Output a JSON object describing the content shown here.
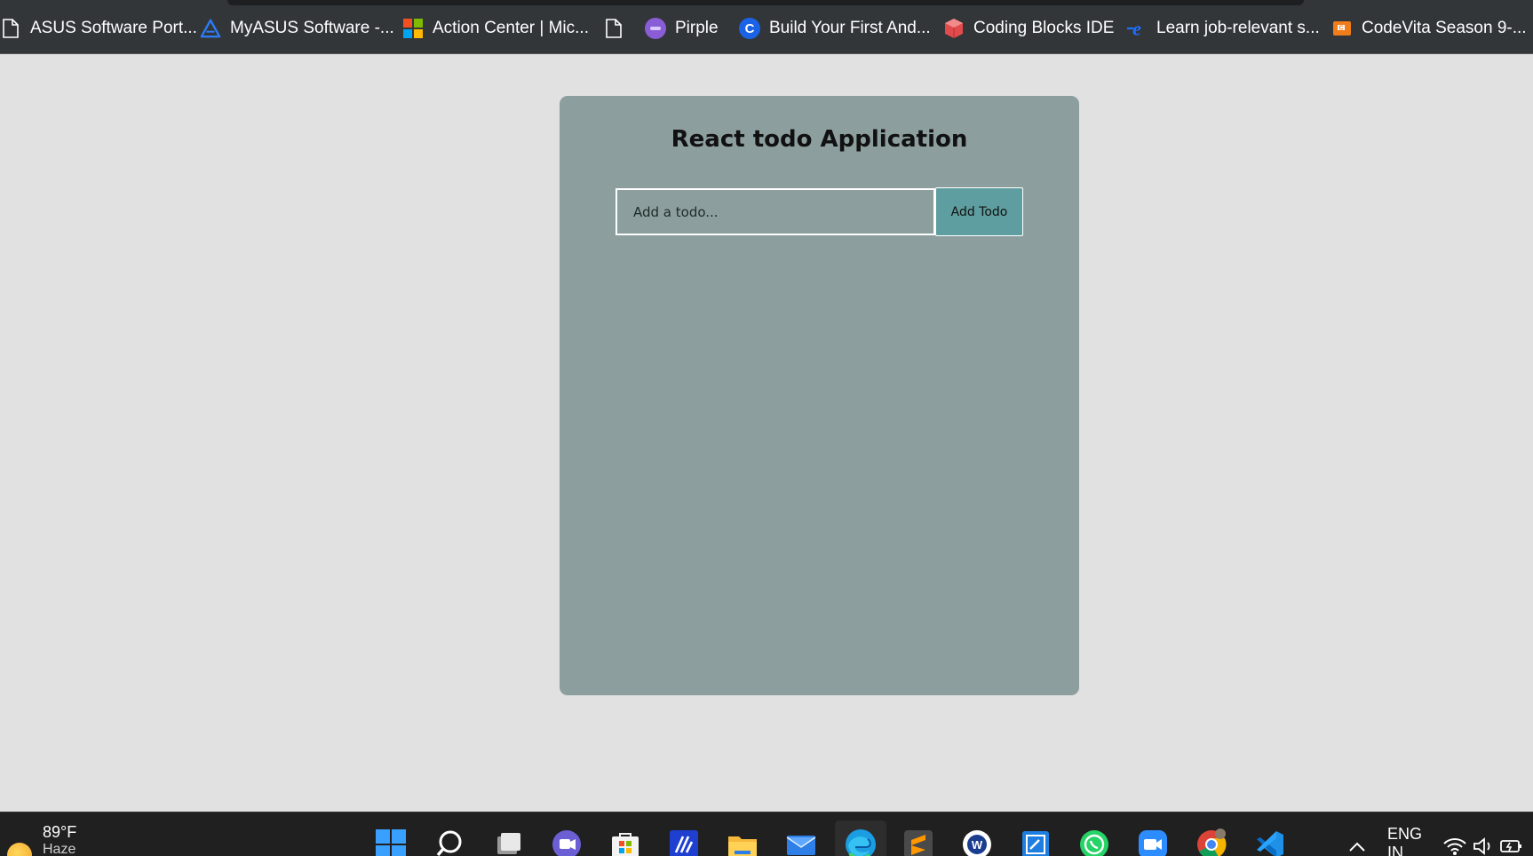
{
  "bookmarks": [
    {
      "label": "ASUS Software Port...",
      "icon": "file-icon"
    },
    {
      "label": "MyASUS Software -...",
      "icon": "myasus-icon"
    },
    {
      "label": "Action Center | Mic...",
      "icon": "microsoft-icon"
    },
    {
      "label": "",
      "icon": "file-icon"
    },
    {
      "label": "Pirple",
      "icon": "pirple-icon"
    },
    {
      "label": "Build Your First And...",
      "icon": "build-icon"
    },
    {
      "label": "Coding Blocks IDE",
      "icon": "coding-blocks-icon"
    },
    {
      "label": "Learn job-relevant s...",
      "icon": "learn-icon"
    },
    {
      "label": "CodeVita Season 9-...",
      "icon": "codevita-icon"
    }
  ],
  "app": {
    "title": "React todo Application",
    "input": {
      "placeholder": "Add a todo...",
      "value": ""
    },
    "add_button_label": "Add Todo"
  },
  "taskbar": {
    "weather": {
      "temperature": "89°F",
      "condition": "Haze"
    },
    "apps": [
      "start-icon",
      "search-icon",
      "task-view-icon",
      "teams-chat-icon",
      "microsoft-store-icon",
      "myasus-app-icon",
      "file-explorer-icon",
      "mail-icon",
      "edge-icon",
      "sublime-text-icon",
      "word-icon",
      "whiteboard-icon",
      "whatsapp-icon",
      "zoom-icon",
      "chrome-icon",
      "vscode-icon"
    ],
    "tray": {
      "language": "ENG",
      "region": "IN"
    }
  },
  "colors": {
    "page_bg": "#e1e1e1",
    "card_bg": "#8c9f9e",
    "button_bg": "#5f9ea0",
    "bookmarks_bg": "#323639",
    "taskbar_bg": "#202020"
  }
}
